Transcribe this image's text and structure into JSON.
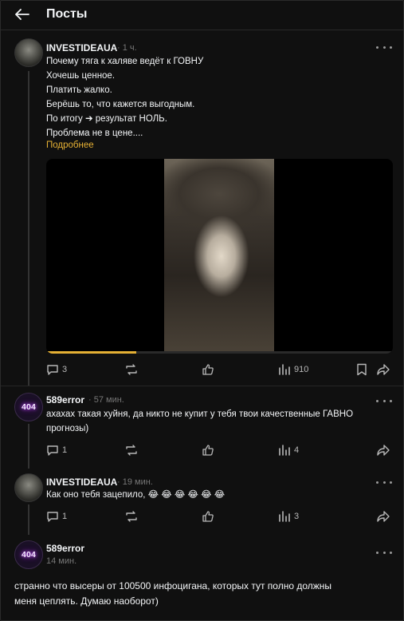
{
  "header": {
    "title": "Посты"
  },
  "post": {
    "username": "INVESTIDEAUA",
    "time": "· 1 ч.",
    "lines": [
      "Почему тяга к халяве ведёт к ГОВНУ",
      "Хочешь ценное.",
      "Платить жалко.",
      "Берёшь то, что кажется выгодным.",
      "По итогу ➔ результат НОЛЬ.",
      "Проблема не в цене...."
    ],
    "more": "Подробнее",
    "video_progress": 0.26,
    "stats": {
      "comments": "3",
      "views": "910"
    }
  },
  "comments": [
    {
      "username": "589error",
      "avatar_text": "404",
      "time": "· 57 мин.",
      "lines": [
        "ахахах такая хуйня, да никто не купит у тебя твои качественные ГАВНО",
        "прогнозы)"
      ],
      "stats": {
        "comments": "1",
        "views": "4"
      }
    },
    {
      "username": "INVESTIDEAUA",
      "time": "· 19 мин.",
      "lines": [
        "Как оно тебя зацепило, 😂 😂 😂 😂 😂 😂"
      ],
      "stats": {
        "comments": "1",
        "views": "3"
      }
    },
    {
      "username": "589error",
      "avatar_text": "404",
      "time": "14 мин.",
      "lines": [
        "странно что высеры от 100500 инфоцигана, которых тут полно должны",
        "меня цеплять. Думаю наоборот)"
      ]
    }
  ],
  "colors": {
    "accent": "#e5b034",
    "background": "#101010",
    "text": "#f3f5f7",
    "muted": "#777777"
  }
}
